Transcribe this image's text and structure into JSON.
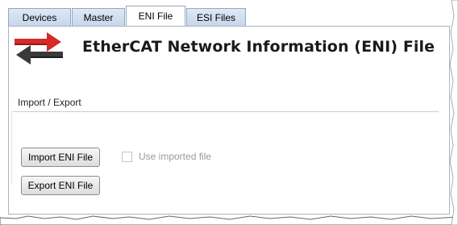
{
  "tabs": [
    {
      "label": "Devices",
      "active": false
    },
    {
      "label": "Master",
      "active": false
    },
    {
      "label": "ENI File",
      "active": true
    },
    {
      "label": "ESI Files",
      "active": false
    }
  ],
  "header": {
    "title": "EtherCAT Network Information (ENI) File",
    "icon": "ethercat-arrows-icon"
  },
  "import_export": {
    "group_label": "Import / Export",
    "import_button": "Import ENI File",
    "export_button": "Export ENI File",
    "use_imported_label": "Use imported file",
    "use_imported_checked": false,
    "use_imported_enabled": false
  },
  "colors": {
    "arrow_red": "#d62b27",
    "arrow_dark": "#3a3a3a",
    "tab_bg": "#c6d6ec"
  }
}
